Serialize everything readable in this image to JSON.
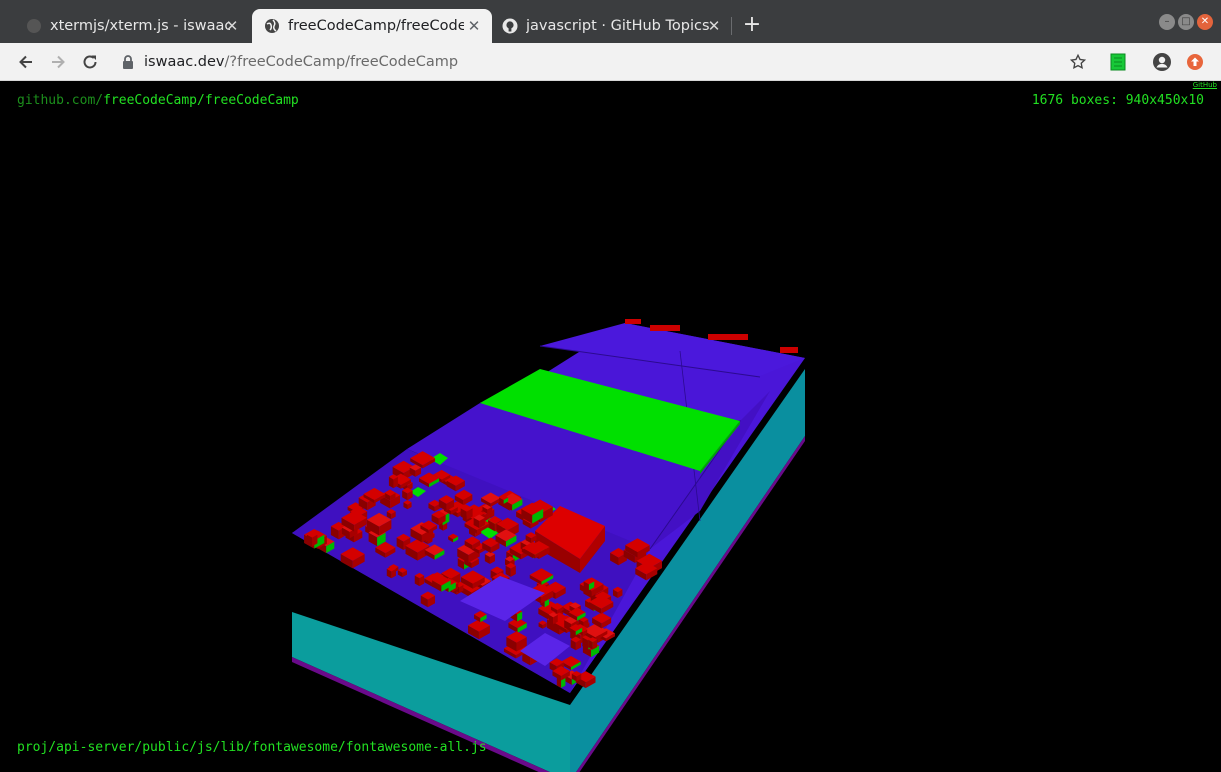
{
  "browser": {
    "tabs": [
      {
        "label": "xtermjs/xterm.js - iswaac",
        "active": false,
        "favicon": "github-icon"
      },
      {
        "label": "freeCodeCamp/freeCode",
        "active": true,
        "favicon": "globe-icon"
      },
      {
        "label": "javascript · GitHub Topics",
        "active": false,
        "favicon": "github-icon"
      }
    ],
    "new_tab": "+",
    "url": {
      "host": "iswaac.dev",
      "path": "/?freeCodeCamp/freeCodeCamp"
    }
  },
  "page": {
    "repo_prefix": "github.com/",
    "repo_name": "freeCodeCamp/freeCodeCamp",
    "stats": "1676 boxes: 940x450x10",
    "github_link": "GitHub",
    "file_path": "proj/api-server/public/js/lib/fontawesome/fontawesome-all.js"
  },
  "colors": {
    "folder": "#4a16d8",
    "file": "#cc0000",
    "highlight": "#00e000",
    "side": "#0aa0a0",
    "text": "#22e022"
  }
}
